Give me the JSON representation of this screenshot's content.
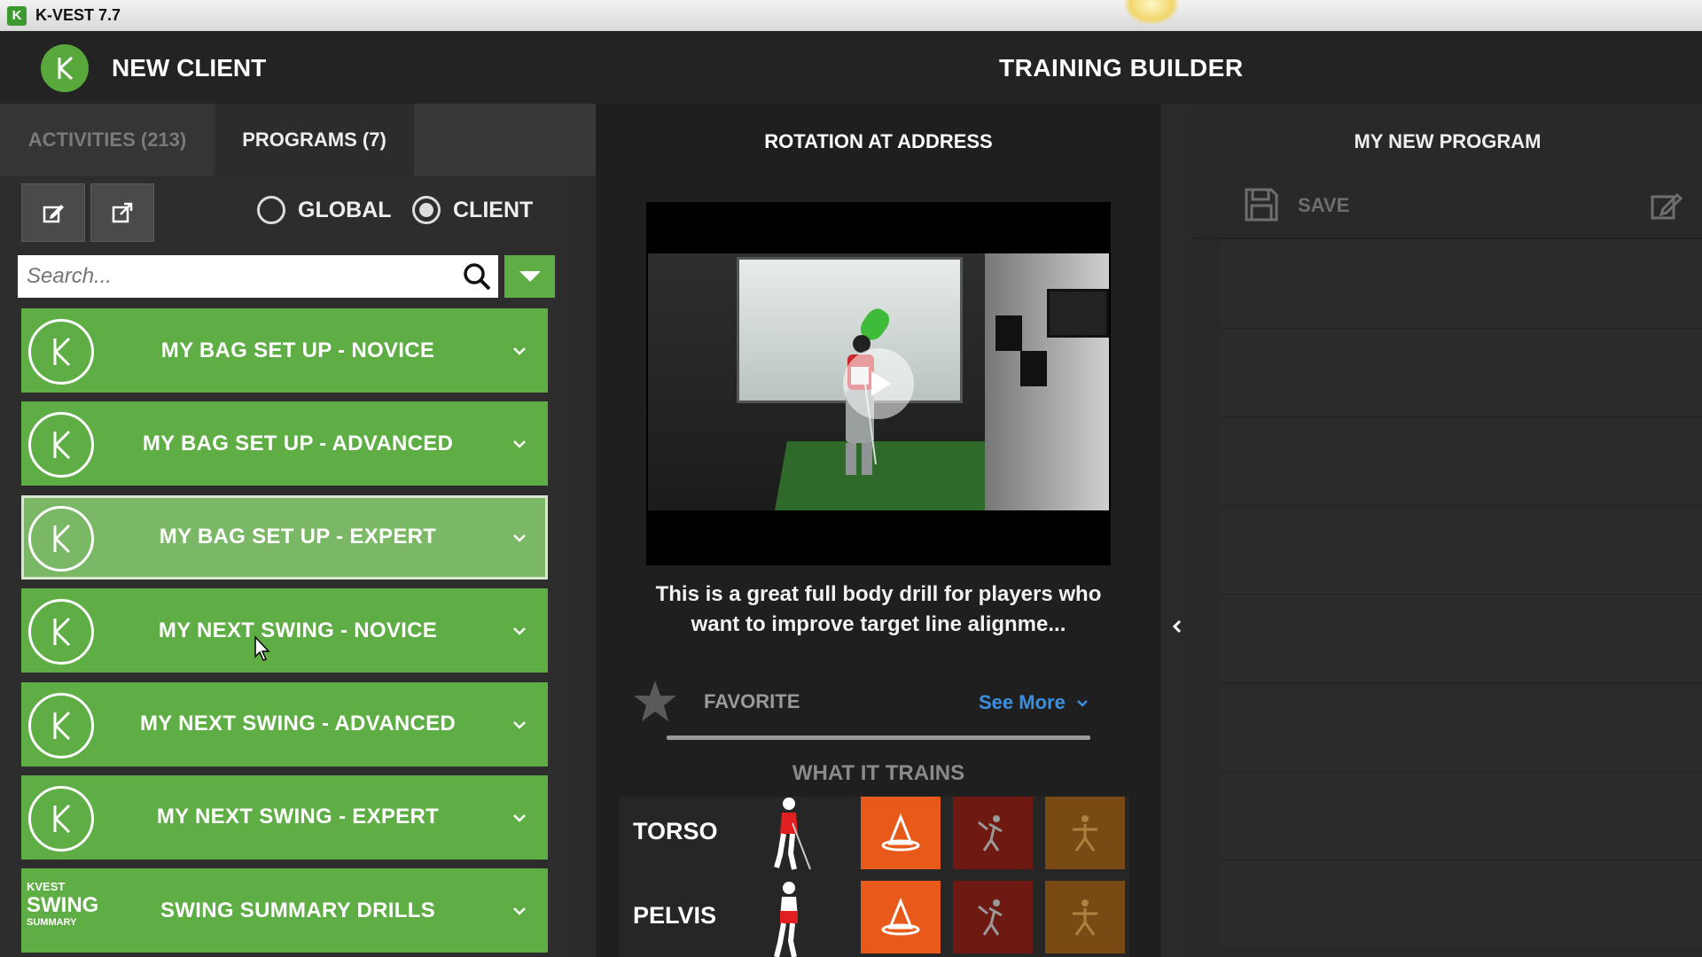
{
  "window": {
    "title": "K-VEST 7.7"
  },
  "header": {
    "client_name": "NEW CLIENT",
    "page_title": "TRAINING BUILDER"
  },
  "left": {
    "tabs": [
      {
        "label": "ACTIVITIES (213)",
        "active": false
      },
      {
        "label": "PROGRAMS (7)",
        "active": true
      }
    ],
    "scope_options": [
      {
        "label": "GLOBAL",
        "selected": false
      },
      {
        "label": "CLIENT",
        "selected": true
      }
    ],
    "search": {
      "placeholder": "Search...",
      "value": ""
    },
    "programs": [
      {
        "label": "MY BAG SET UP - NOVICE",
        "icon": "k-logo-icon"
      },
      {
        "label": "MY BAG SET UP - ADVANCED",
        "icon": "k-logo-icon"
      },
      {
        "label": "MY BAG SET UP - EXPERT",
        "icon": "k-logo-icon",
        "selected": true
      },
      {
        "label": "MY NEXT SWING - NOVICE",
        "icon": "k-logo-icon"
      },
      {
        "label": "MY NEXT SWING - ADVANCED",
        "icon": "k-logo-icon"
      },
      {
        "label": "MY NEXT SWING - EXPERT",
        "icon": "k-logo-icon"
      },
      {
        "label": "SWING SUMMARY DRILLS",
        "icon": "swing-summary-logo",
        "icon_text": [
          "KVEST",
          "SWING",
          "SUMMARY"
        ]
      }
    ]
  },
  "activity": {
    "title": "ROTATION AT ADDRESS",
    "description": "This is a great full body drill for players who want to improve target line alignme...",
    "favorite_label": "FAVORITE",
    "see_more": "See More",
    "what_it_trains": "WHAT IT TRAINS",
    "trains": [
      {
        "label": "TORSO"
      },
      {
        "label": "PELVIS"
      }
    ]
  },
  "program": {
    "title": "MY NEW PROGRAM",
    "save_label": "SAVE"
  },
  "colors": {
    "accent_green": "#5fae45",
    "orange": "#e85a1a",
    "link_blue": "#3b8fe0"
  }
}
